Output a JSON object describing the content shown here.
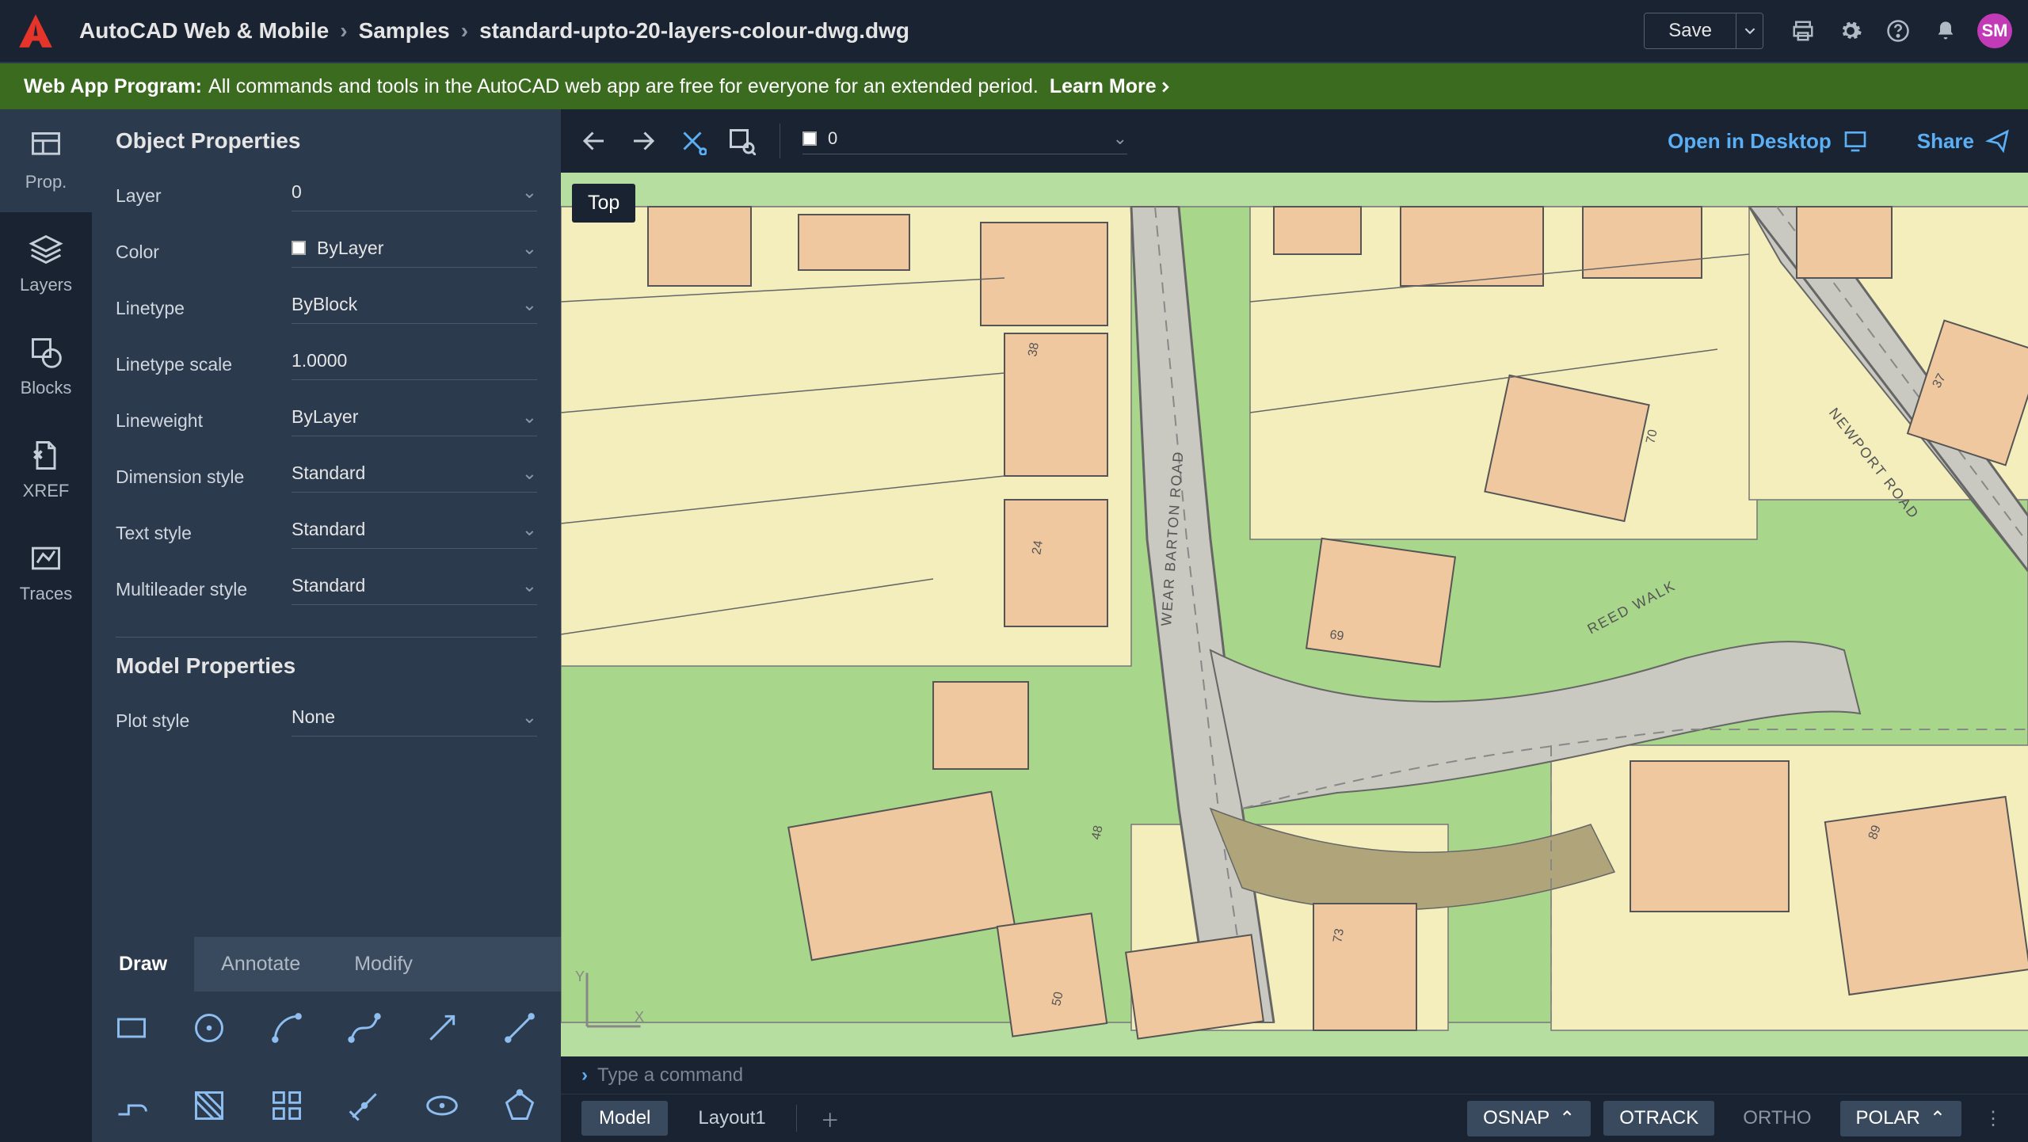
{
  "titlebar": {
    "product": "AutoCAD Web & Mobile",
    "folder": "Samples",
    "file": "standard-upto-20-layers-colour-dwg.dwg",
    "save": "Save",
    "avatar": "SM"
  },
  "banner": {
    "title": "Web App Program:",
    "body": "All commands and tools in the AutoCAD web app are free for everyone for an extended period.",
    "link": "Learn More"
  },
  "rail": {
    "prop": "Prop.",
    "layers": "Layers",
    "blocks": "Blocks",
    "xref": "XREF",
    "traces": "Traces"
  },
  "panel": {
    "object_heading": "Object Properties",
    "model_heading": "Model Properties",
    "labels": {
      "layer": "Layer",
      "color": "Color",
      "linetype": "Linetype",
      "linetype_scale": "Linetype scale",
      "lineweight": "Lineweight",
      "dim_style": "Dimension style",
      "text_style": "Text style",
      "ml_style": "Multileader style",
      "plot_style": "Plot style"
    },
    "values": {
      "layer": "0",
      "color": "ByLayer",
      "linetype": "ByBlock",
      "linetype_scale": "1.0000",
      "lineweight": "ByLayer",
      "dim_style": "Standard",
      "text_style": "Standard",
      "ml_style": "Standard",
      "plot_style": "None"
    }
  },
  "tooltabs": {
    "draw": "Draw",
    "annotate": "Annotate",
    "modify": "Modify"
  },
  "tools": [
    "rectangle",
    "circle",
    "arc",
    "spline",
    "line-arrow",
    "line",
    "polyline",
    "hatch",
    "array",
    "dimension",
    "ellipse",
    "polygon"
  ],
  "toolbar": {
    "layer": "0",
    "open_desktop": "Open in Desktop",
    "share": "Share"
  },
  "canvas": {
    "view_label": "Top",
    "roads": [
      "WEAR BARTON ROAD",
      "REED WALK",
      "NEWPORT ROAD"
    ],
    "house_numbers": [
      "38",
      "24",
      "48",
      "50",
      "69",
      "73",
      "70",
      "37",
      "89"
    ]
  },
  "cmdbar": {
    "placeholder": "Type a command"
  },
  "statusbar": {
    "tabs": [
      "Model",
      "Layout1"
    ],
    "toggles": {
      "osnap": "OSNAP",
      "otrack": "OTRACK",
      "ortho": "ORTHO",
      "polar": "POLAR"
    }
  }
}
